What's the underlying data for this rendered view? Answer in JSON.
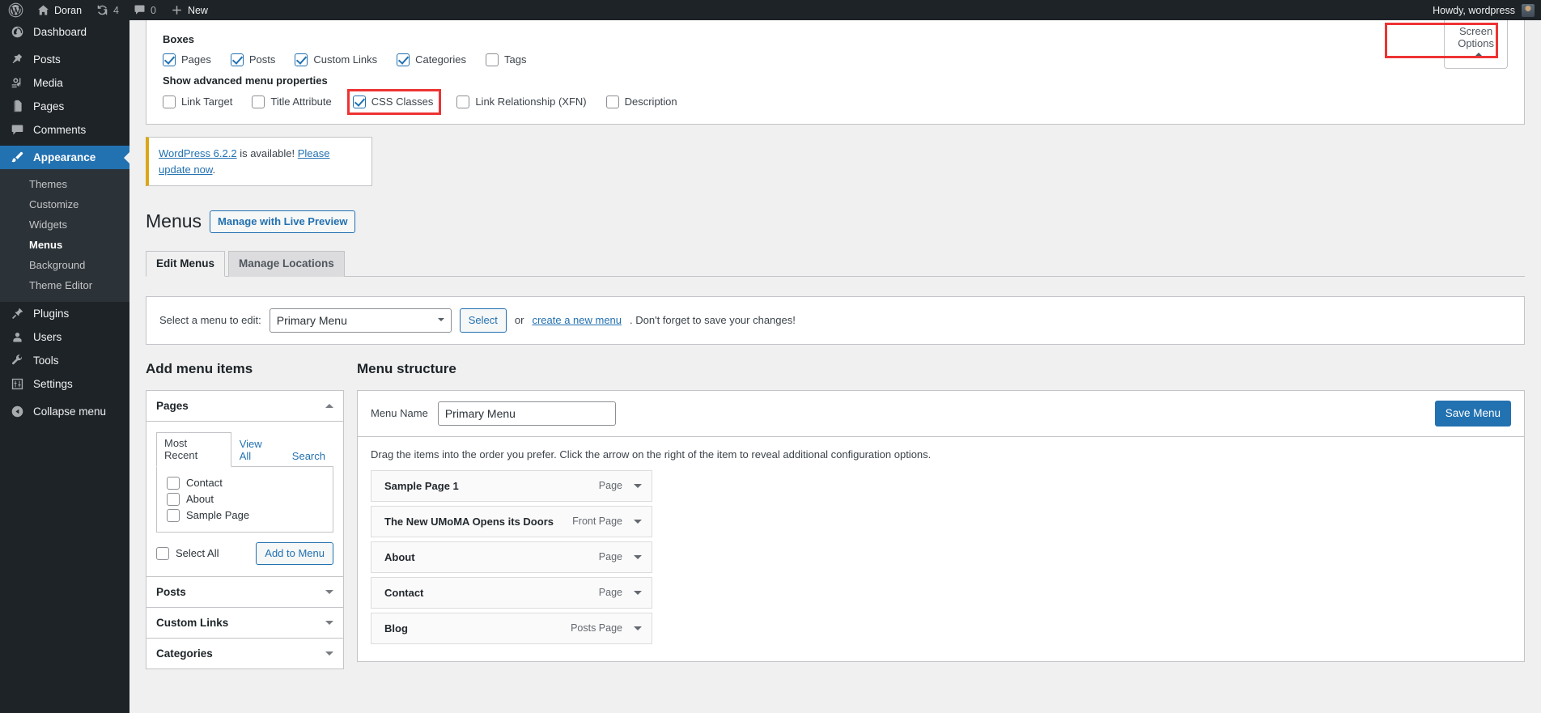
{
  "adminbar": {
    "wp_logo": "wordpress-logo-icon",
    "site_name": "Doran",
    "updates_count": "4",
    "comments_count": "0",
    "new_label": "New",
    "howdy": "Howdy, wordpress"
  },
  "sidebar": {
    "items": [
      {
        "label": "Dashboard",
        "icon": "dashboard-icon",
        "state": "normal"
      },
      {
        "label": "Posts",
        "icon": "posts-pin-icon",
        "state": "normal"
      },
      {
        "label": "Media",
        "icon": "media-icon",
        "state": "normal"
      },
      {
        "label": "Pages",
        "icon": "pages-icon",
        "state": "normal"
      },
      {
        "label": "Comments",
        "icon": "comments-icon",
        "state": "normal"
      },
      {
        "label": "Appearance",
        "icon": "appearance-brush-icon",
        "state": "current"
      },
      {
        "label": "Plugins",
        "icon": "plugins-plug-icon",
        "state": "normal"
      },
      {
        "label": "Users",
        "icon": "users-icon",
        "state": "normal"
      },
      {
        "label": "Tools",
        "icon": "tools-wrench-icon",
        "state": "normal"
      },
      {
        "label": "Settings",
        "icon": "settings-sliders-icon",
        "state": "normal"
      },
      {
        "label": "Collapse menu",
        "icon": "collapse-arrow-icon",
        "state": "normal"
      }
    ],
    "appearance_submenu": [
      {
        "label": "Themes",
        "current": false
      },
      {
        "label": "Customize",
        "current": false
      },
      {
        "label": "Widgets",
        "current": false
      },
      {
        "label": "Menus",
        "current": true
      },
      {
        "label": "Background",
        "current": false
      },
      {
        "label": "Theme Editor",
        "current": false
      }
    ]
  },
  "screen_options": {
    "boxes_legend": "Boxes",
    "boxes": [
      {
        "label": "Pages",
        "checked": true
      },
      {
        "label": "Posts",
        "checked": true
      },
      {
        "label": "Custom Links",
        "checked": true
      },
      {
        "label": "Categories",
        "checked": true
      },
      {
        "label": "Tags",
        "checked": false
      }
    ],
    "advanced_legend": "Show advanced menu properties",
    "advanced": [
      {
        "label": "Link Target",
        "checked": false,
        "highlighted": false
      },
      {
        "label": "Title Attribute",
        "checked": false,
        "highlighted": false
      },
      {
        "label": "CSS Classes",
        "checked": true,
        "highlighted": true
      },
      {
        "label": "Link Relationship (XFN)",
        "checked": false,
        "highlighted": false
      },
      {
        "label": "Description",
        "checked": false,
        "highlighted": false
      }
    ],
    "toggle_label": "Screen Options",
    "toggle_highlighted": true
  },
  "notice": {
    "link_version": "WordPress 6.2.2",
    "middle_text": " is available! ",
    "link_update": "Please update now",
    "end_text": "."
  },
  "page": {
    "title": "Menus",
    "title_action": "Manage with Live Preview",
    "tabs": [
      {
        "label": "Edit Menus",
        "active": true
      },
      {
        "label": "Manage Locations",
        "active": false
      }
    ]
  },
  "menu_select": {
    "label": "Select a menu to edit:",
    "selected": "Primary Menu",
    "options": [
      "Primary Menu"
    ],
    "select_button": "Select",
    "or_text": "or ",
    "create_link": "create a new menu",
    "tail_text": ". Don't forget to save your changes!"
  },
  "add_menu_items": {
    "heading": "Add menu items",
    "accordions": [
      {
        "title": "Pages",
        "open": true
      },
      {
        "title": "Posts",
        "open": false
      },
      {
        "title": "Custom Links",
        "open": false
      },
      {
        "title": "Categories",
        "open": false
      }
    ],
    "pages_panel": {
      "tabs": [
        {
          "label": "Most Recent",
          "active": true
        },
        {
          "label": "View All",
          "active": false
        },
        {
          "label": "Search",
          "active": false
        }
      ],
      "items": [
        {
          "label": "Contact",
          "checked": false
        },
        {
          "label": "About",
          "checked": false
        },
        {
          "label": "Sample Page",
          "checked": false
        }
      ],
      "select_all": "Select All",
      "select_all_checked": false,
      "add_button": "Add to Menu"
    }
  },
  "menu_structure": {
    "heading": "Menu structure",
    "name_label": "Menu Name",
    "name_value": "Primary Menu",
    "name_placeholder": "Menu Name",
    "save_button": "Save Menu",
    "drag_hint": "Drag the items into the order you prefer. Click the arrow on the right of the item to reveal additional configuration options.",
    "items": [
      {
        "title": "Sample Page 1",
        "type": "Page"
      },
      {
        "title": "The New UMoMA Opens its Doors",
        "type": "Front Page"
      },
      {
        "title": "About",
        "type": "Page"
      },
      {
        "title": "Contact",
        "type": "Page"
      },
      {
        "title": "Blog",
        "type": "Posts Page"
      }
    ]
  },
  "colors": {
    "accent": "#2271b1",
    "admin_bg": "#1d2327",
    "submenu_bg": "#2c3338",
    "highlight_red": "#ee3333",
    "notice_amber": "#dba617",
    "page_bg": "#f0f0f1"
  }
}
